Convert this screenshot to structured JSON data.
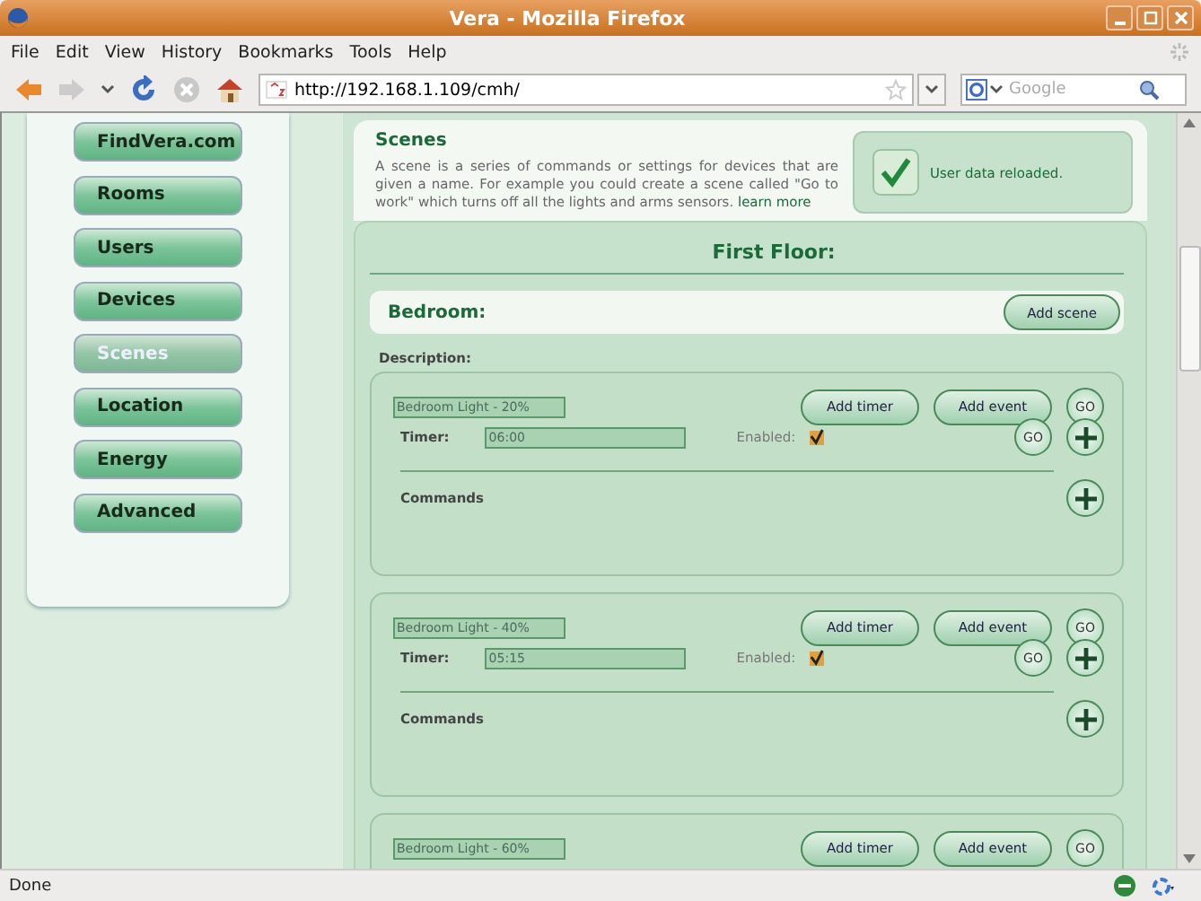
{
  "window": {
    "title": "Vera - Mozilla Firefox"
  },
  "menu": [
    {
      "label": "File"
    },
    {
      "label": "Edit"
    },
    {
      "label": "View"
    },
    {
      "label": "History"
    },
    {
      "label": "Bookmarks"
    },
    {
      "label": "Tools"
    },
    {
      "label": "Help"
    }
  ],
  "address_bar": {
    "value": "http://192.168.1.109/cmh/"
  },
  "search": {
    "placeholder": "Google"
  },
  "sidebar": {
    "items": [
      {
        "label": "FindVera.com",
        "selected": false
      },
      {
        "label": "Rooms",
        "selected": false
      },
      {
        "label": "Users",
        "selected": false
      },
      {
        "label": "Devices",
        "selected": false
      },
      {
        "label": "Scenes",
        "selected": true
      },
      {
        "label": "Location",
        "selected": false
      },
      {
        "label": "Energy",
        "selected": false
      },
      {
        "label": "Advanced",
        "selected": false
      }
    ]
  },
  "header": {
    "title": "Scenes",
    "text": "A scene is a series of commands or settings for devices that are given a name. For example you could create a scene called \"Go to work\" which turns off all the lights and arms sensors.",
    "link": "learn more"
  },
  "notice": {
    "text": "User data reloaded."
  },
  "floor": {
    "title": "First Floor:"
  },
  "room": {
    "name": "Bedroom:",
    "button": "Add scene",
    "description_label": "Description:"
  },
  "scenes": [
    {
      "name": "Bedroom Light - 20%",
      "add_timer": "Add timer",
      "add_event": "Add event",
      "go": "GO",
      "timer_label": "Timer:",
      "timer": "06:00",
      "enabled_label": "Enabled:",
      "enabled": true,
      "timer_go": "GO",
      "commands_label": "Commands"
    },
    {
      "name": "Bedroom Light - 40%",
      "add_timer": "Add timer",
      "add_event": "Add event",
      "go": "GO",
      "timer_label": "Timer:",
      "timer": "05:15",
      "enabled_label": "Enabled:",
      "enabled": true,
      "timer_go": "GO",
      "commands_label": "Commands"
    },
    {
      "name": "Bedroom Light - 60%",
      "add_timer": "Add timer",
      "add_event": "Add event",
      "go": "GO"
    }
  ],
  "status_bar": {
    "text": "Done"
  }
}
